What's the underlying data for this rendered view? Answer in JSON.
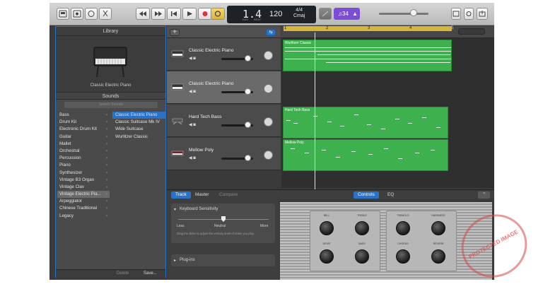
{
  "toolbar": {
    "lcd_bar": "1.4",
    "lcd_bar_label": "BAR",
    "lcd_beat_label": "BEAT",
    "lcd_tempo": "120",
    "lcd_sig": "4/4",
    "lcd_key": "Cmaj",
    "key_button": "♫34",
    "icons": [
      "library-icon",
      "smart-controls-icon",
      "editors-icon",
      "cycle-icon",
      "scissors-icon",
      "rewind-icon",
      "forward-icon",
      "go-to-start-icon",
      "play-icon",
      "record-icon",
      "cycle-mode-icon",
      "metronome-icon",
      "tuner-icon",
      "loops-icon",
      "notepad-icon",
      "share-icon"
    ]
  },
  "library": {
    "title": "Library",
    "preview_name": "Classic Electric Piano",
    "sounds_header": "Sounds",
    "search_placeholder": "Search Sounds",
    "categories": [
      {
        "label": "Bass"
      },
      {
        "label": "Drum Kit"
      },
      {
        "label": "Electronic Drum Kit"
      },
      {
        "label": "Guitar"
      },
      {
        "label": "Mallet"
      },
      {
        "label": "Orchestral"
      },
      {
        "label": "Percussion"
      },
      {
        "label": "Piano"
      },
      {
        "label": "Synthesizer"
      },
      {
        "label": "Vintage B3 Organ"
      },
      {
        "label": "Vintage Clav"
      },
      {
        "label": "Vintage Electric Pia..."
      },
      {
        "label": "Arpeggiator"
      },
      {
        "label": "Chinese Traditional"
      },
      {
        "label": "Legacy"
      }
    ],
    "selected_category": 11,
    "patches": [
      {
        "label": "Classic Electric Piano"
      },
      {
        "label": "Classic Suitcase Mk IV"
      },
      {
        "label": "Wide Suitcase"
      },
      {
        "label": "Wurlitzer Classic"
      }
    ],
    "selected_patch": 0,
    "delete_label": "Delete",
    "save_label": "Save..."
  },
  "tracks": [
    {
      "name": "Classic Electric Piano",
      "volume": 0.82
    },
    {
      "name": "Classic Electric Piano",
      "volume": 0.82
    },
    {
      "name": "Hard Tech Bass",
      "volume": 0.82
    },
    {
      "name": "Mellow Poly",
      "volume": 0.82
    }
  ],
  "timeline": {
    "ruler_numbers": [
      "1",
      "2",
      "3",
      "4",
      "5"
    ],
    "regions": [
      {
        "label": "Wurlitzer Classic"
      },
      {
        "label": "Hard Tech Bass"
      },
      {
        "label": "Mellow Poly"
      }
    ]
  },
  "editor": {
    "tabs": [
      "Track",
      "Master",
      "Compare"
    ],
    "active_tab": "Track",
    "right_tabs": [
      "Controls",
      "EQ"
    ],
    "active_right_tab": "Controls",
    "keyboard_sensitivity_label": "Keyboard Sensitivity",
    "slider_less": "Less",
    "slider_neutral": "Neutral",
    "slider_more": "More",
    "slider_value": 0.5,
    "help_text": "Drag the slider to adjust the velocity level of notes you play.",
    "plugins_label": "Plug-ins"
  },
  "instrument": {
    "knob_labels_top": [
      "BELL",
      "TREBLE",
      "TREMOLO",
      "HARDNESS"
    ],
    "knob_labels_bottom": [
      "DRIVE",
      "BASS",
      "CHORUS",
      "REVERB"
    ]
  },
  "watermark": {
    "text": "PROTECTED IMAGE"
  },
  "colors": {
    "accent": "#2a72c8",
    "region_green": "#3cb14e",
    "cycle_yellow": "#d8b53b",
    "key_purple": "#7c4ed8",
    "record_red": "#e0303a"
  }
}
